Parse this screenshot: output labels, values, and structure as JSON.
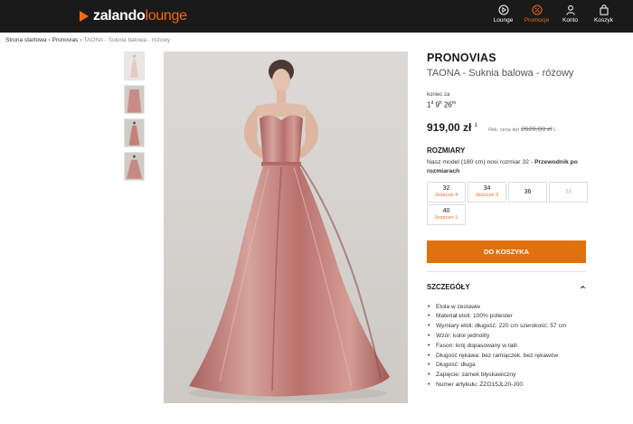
{
  "header": {
    "logo_main": "zalando",
    "logo_accent": "lounge",
    "nav": [
      {
        "label": "Lounge",
        "icon": "play-icon"
      },
      {
        "label": "Promocje",
        "icon": "percent-icon"
      },
      {
        "label": "Konto",
        "icon": "user-icon"
      },
      {
        "label": "Koszyk",
        "icon": "bag-icon"
      }
    ],
    "active_color": "#f26a0f"
  },
  "breadcrumb": {
    "items": [
      "Strona startowa",
      "Pronovias"
    ],
    "current": "TAONA - Suknia balowa - różowy"
  },
  "product": {
    "brand": "PRONOVIAS",
    "title": "TAONA - Suknia balowa - różowy",
    "ends_label": "koniec za",
    "countdown": {
      "d": "1",
      "h": "9",
      "m": "26",
      "d_unit": "d",
      "h_unit": "h",
      "m_unit": "m"
    },
    "price": "919,00 zł",
    "price_note": "1",
    "old_price_label": "Rek. cena det",
    "old_price": "2620,00 zł",
    "old_price_note": "1"
  },
  "sizes": {
    "heading": "ROZMIARY",
    "model_note": "Nasz model (180 cm) nosi rozmiar 32 - ",
    "guide_link": "Przewodnik po rozmiarach",
    "options": [
      {
        "size": "32",
        "stock": "Jeszcze 4"
      },
      {
        "size": "34",
        "stock": "Jeszcze 3"
      },
      {
        "size": "36",
        "stock": ""
      },
      {
        "size": "38",
        "stock": ""
      },
      {
        "size": "40",
        "stock": "Jeszcze 1"
      }
    ]
  },
  "cta": {
    "label": "DO KOSZYKA",
    "color": "#e0710f"
  },
  "details": {
    "heading": "SZCZEGÓŁY",
    "items": [
      "Etola w zestawie",
      "Materiał etoli: 100% poliester",
      "Wymiary etoli: długość: 220 cm szerokość: 57 cm",
      "Wzór: kolor jednolity",
      "Fason: krój dopasowany w talii",
      "Długość rękawa: bez ramiączek, bez rękawów",
      "Długość: długa",
      "Zapięcie: zamek błyskawiczny",
      "Numer artykułu: ZZO15JL20-J00"
    ]
  }
}
